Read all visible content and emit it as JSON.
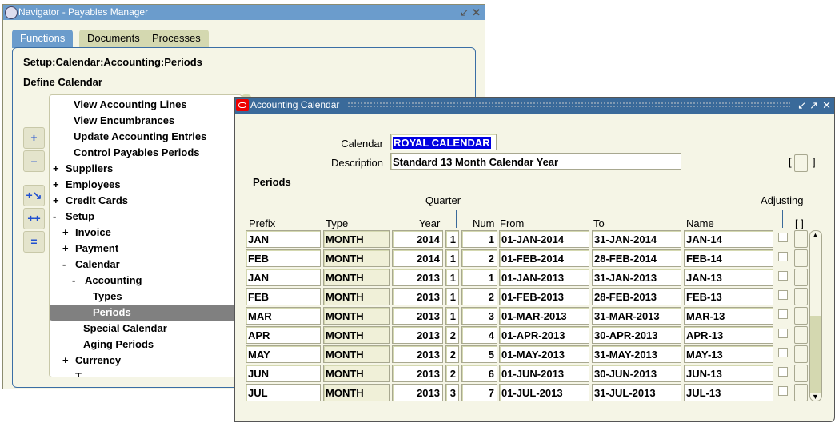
{
  "navigator": {
    "title": "Navigator - Payables Manager",
    "tabs": [
      "Functions",
      "Documents",
      "Processes"
    ],
    "path": "Setup:Calendar:Accounting:Periods",
    "selected_function": "Define Calendar",
    "tree": [
      {
        "label": "View Accounting Lines",
        "prefix": "",
        "indent": 2
      },
      {
        "label": "View Encumbrances",
        "prefix": "",
        "indent": 2
      },
      {
        "label": "Update Accounting Entries",
        "prefix": "",
        "indent": 2
      },
      {
        "label": "Control Payables Periods",
        "prefix": "",
        "indent": 2
      },
      {
        "label": "Suppliers",
        "prefix": "+",
        "indent": 0
      },
      {
        "label": "Employees",
        "prefix": "+",
        "indent": 0
      },
      {
        "label": "Credit Cards",
        "prefix": "+",
        "indent": 0
      },
      {
        "label": "Setup",
        "prefix": "-",
        "indent": 0
      },
      {
        "label": "Invoice",
        "prefix": "+",
        "indent": 1
      },
      {
        "label": "Payment",
        "prefix": "+",
        "indent": 1
      },
      {
        "label": "Calendar",
        "prefix": "-",
        "indent": 1
      },
      {
        "label": "Accounting",
        "prefix": "-",
        "indent": 2
      },
      {
        "label": "Types",
        "prefix": "",
        "indent": 4
      },
      {
        "label": "Periods",
        "prefix": "",
        "indent": 4,
        "selected": true
      },
      {
        "label": "Special Calendar",
        "prefix": "",
        "indent": 3
      },
      {
        "label": "Aging Periods",
        "prefix": "",
        "indent": 3
      },
      {
        "label": "Currency",
        "prefix": "+",
        "indent": 1
      },
      {
        "label": "T...",
        "prefix": "",
        "indent": 1
      }
    ],
    "buttons": [
      "expand-icon",
      "collapse-icon",
      "expand-branch-icon",
      "expand-all-icon",
      "collapse-all-icon"
    ]
  },
  "calendar_window": {
    "title": "Accounting Calendar",
    "calendar_label": "Calendar",
    "calendar_value": "ROYAL CALENDAR",
    "description_label": "Description",
    "description_value": "Standard 13 Month Calendar Year",
    "dff": "[ ]",
    "periods_section": "Periods",
    "headers": {
      "quarter": "Quarter",
      "adjusting": "Adjusting",
      "prefix": "Prefix",
      "type": "Type",
      "year": "Year",
      "num": "Num",
      "from": "From",
      "to": "To",
      "name": "Name",
      "dff": "[ ]"
    },
    "rows": [
      {
        "prefix": "JAN",
        "type": "MONTH",
        "year": "2014",
        "quarter": "1",
        "num": "1",
        "from": "01-JAN-2014",
        "to": "31-JAN-2014",
        "name": "JAN-14",
        "adjusting": false
      },
      {
        "prefix": "FEB",
        "type": "MONTH",
        "year": "2014",
        "quarter": "1",
        "num": "2",
        "from": "01-FEB-2014",
        "to": "28-FEB-2014",
        "name": "FEB-14",
        "adjusting": false
      },
      {
        "prefix": "JAN",
        "type": "MONTH",
        "year": "2013",
        "quarter": "1",
        "num": "1",
        "from": "01-JAN-2013",
        "to": "31-JAN-2013",
        "name": "JAN-13",
        "adjusting": false
      },
      {
        "prefix": "FEB",
        "type": "MONTH",
        "year": "2013",
        "quarter": "1",
        "num": "2",
        "from": "01-FEB-2013",
        "to": "28-FEB-2013",
        "name": "FEB-13",
        "adjusting": false
      },
      {
        "prefix": "MAR",
        "type": "MONTH",
        "year": "2013",
        "quarter": "1",
        "num": "3",
        "from": "01-MAR-2013",
        "to": "31-MAR-2013",
        "name": "MAR-13",
        "adjusting": false
      },
      {
        "prefix": "APR",
        "type": "MONTH",
        "year": "2013",
        "quarter": "2",
        "num": "4",
        "from": "01-APR-2013",
        "to": "30-APR-2013",
        "name": "APR-13",
        "adjusting": false
      },
      {
        "prefix": "MAY",
        "type": "MONTH",
        "year": "2013",
        "quarter": "2",
        "num": "5",
        "from": "01-MAY-2013",
        "to": "31-MAY-2013",
        "name": "MAY-13",
        "adjusting": false
      },
      {
        "prefix": "JUN",
        "type": "MONTH",
        "year": "2013",
        "quarter": "2",
        "num": "6",
        "from": "01-JUN-2013",
        "to": "30-JUN-2013",
        "name": "JUN-13",
        "adjusting": false
      },
      {
        "prefix": "JUL",
        "type": "MONTH",
        "year": "2013",
        "quarter": "3",
        "num": "7",
        "from": "01-JUL-2013",
        "to": "31-JUL-2013",
        "name": "JUL-13",
        "adjusting": false
      }
    ]
  },
  "colors": {
    "nav_title": "#6b9ccc",
    "cal_title": "#3a6a9a",
    "background": "#f5f5e6",
    "selection": "#0000e0",
    "tree_selected": "#808080"
  }
}
